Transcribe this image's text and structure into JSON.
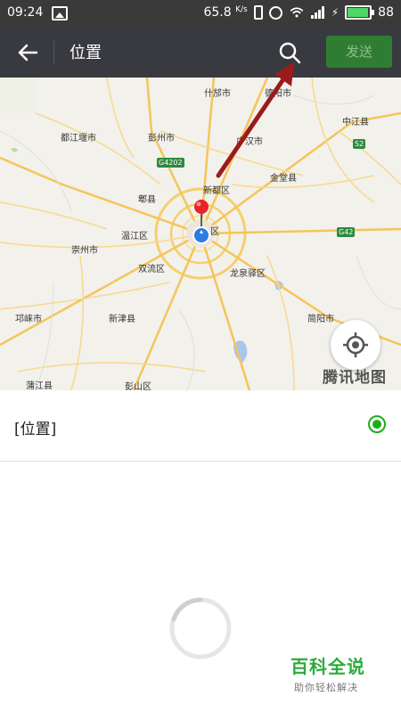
{
  "status_bar": {
    "time": "09:24",
    "speed": "65.8",
    "speed_unit": "K/s",
    "battery": "88"
  },
  "toolbar": {
    "title": "位置",
    "send_label": "发送"
  },
  "map": {
    "labels": {
      "shifang": "什邡市",
      "deyang": "德阳市",
      "zhongjiang": "中江县",
      "dujiangyan": "都江堰市",
      "pengzhou": "彭州市",
      "guanghan": "广汉市",
      "jintang": "金堂县",
      "xindu": "新都区",
      "pixian": "郫县",
      "wenjiang": "温江区",
      "district": "区",
      "chongzhou": "崇州市",
      "shuangliu": "双流区",
      "longquanyi": "龙泉驿区",
      "qionglai": "邛崃市",
      "xinjin": "新津县",
      "jianyang": "简阳市",
      "pujiang": "蒲江县",
      "pengshan": "彭山区"
    },
    "highways": {
      "g4202": "G4202",
      "s2": "S2",
      "g42": "G42"
    },
    "logo": "腾讯地图"
  },
  "location": {
    "name": "[位置]"
  },
  "watermark": {
    "title": "百科全说",
    "subtitle": "助你轻松解决"
  }
}
